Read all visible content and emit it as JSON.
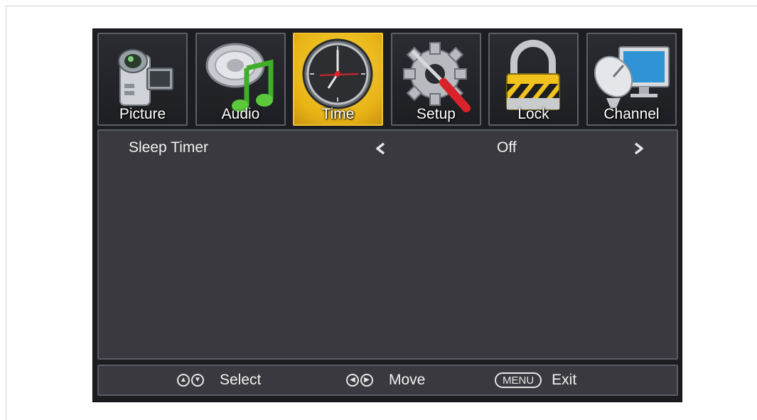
{
  "tabs": [
    {
      "label": "Picture",
      "icon": "camcorder-icon",
      "active": false
    },
    {
      "label": "Audio",
      "icon": "speaker-music-note-icon",
      "active": false
    },
    {
      "label": "Time",
      "icon": "clock-icon",
      "active": true
    },
    {
      "label": "Setup",
      "icon": "gear-screwdriver-icon",
      "active": false
    },
    {
      "label": "Lock",
      "icon": "padlock-icon",
      "active": false
    },
    {
      "label": "Channel",
      "icon": "satellite-dish-monitor-icon",
      "active": false
    }
  ],
  "content": {
    "sleep_timer": {
      "label": "Sleep Timer",
      "value": "Off",
      "left_arrow": "left-arrow-icon",
      "right_arrow": "right-arrow-icon"
    }
  },
  "footer": {
    "select_label": "Select",
    "move_label": "Move",
    "menu_key": "MENU",
    "exit_label": "Exit"
  },
  "colors": {
    "active_tab": "#e8b315",
    "panel": "#39393f",
    "osd_background": "#1c1d20"
  }
}
